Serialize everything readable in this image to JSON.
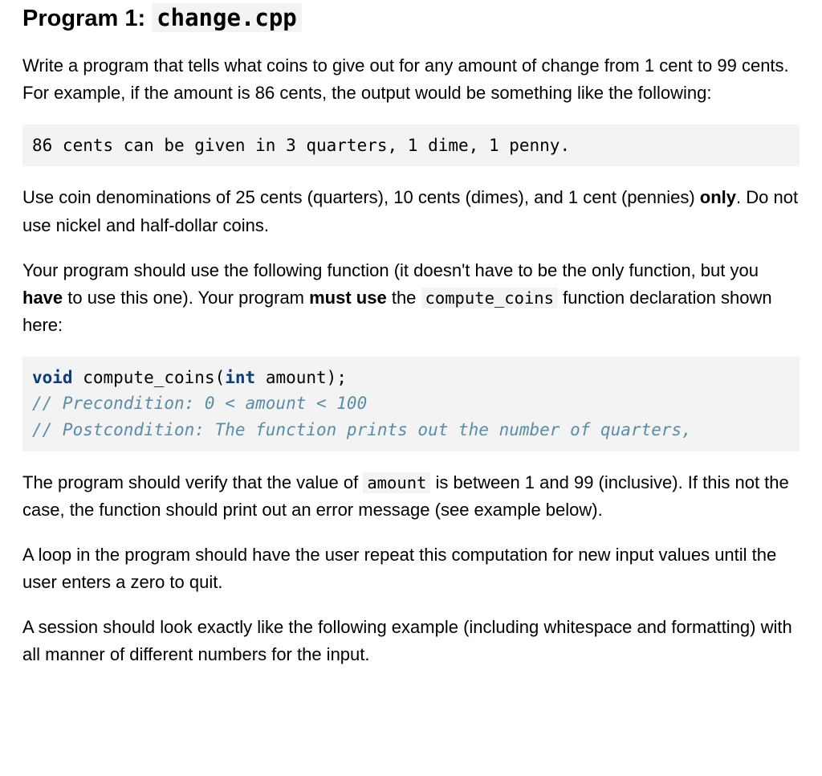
{
  "heading_prefix": "Program 1: ",
  "heading_code": "change.cpp",
  "p1": "Write a program that tells what coins to give out for any amount of change from 1 cent to 99 cents. For example, if the amount is 86 cents, the output would be something like the following:",
  "code1": "86 cents can be given in 3 quarters, 1 dime, 1 penny.",
  "p2a": "Use coin denominations of 25 cents (quarters), 10 cents (dimes), and 1 cent (pennies) ",
  "p2b_strong": "only",
  "p2c": ". Do not use nickel and half-dollar coins.",
  "p3a": "Your program should use the following function (it doesn't have to be the only function, but you ",
  "p3b_strong": "have",
  "p3c": " to use this one). Your program ",
  "p3d_strong": "must use",
  "p3e": " the ",
  "p3f_code": "compute_coins",
  "p3g": " function declaration shown here:",
  "code2": {
    "kw_void": "void",
    "fn_open": " compute_coins(",
    "kw_int": "int",
    "fn_close": " amount);",
    "cm1": "// Precondition: 0 < amount < 100",
    "cm2": "// Postcondition: The function prints out the number of quarters,"
  },
  "p4a": "The program should verify that the value of ",
  "p4b_code": "amount",
  "p4c": " is between 1 and 99 (inclusive). If this not the case, the function should print out an error message (see example below).",
  "p5": "A loop in the program should have the user repeat this computation for new input values until the user enters a zero to quit.",
  "p6": "A session should look exactly like the following example (including whitespace and formatting) with all manner of different numbers for the input."
}
